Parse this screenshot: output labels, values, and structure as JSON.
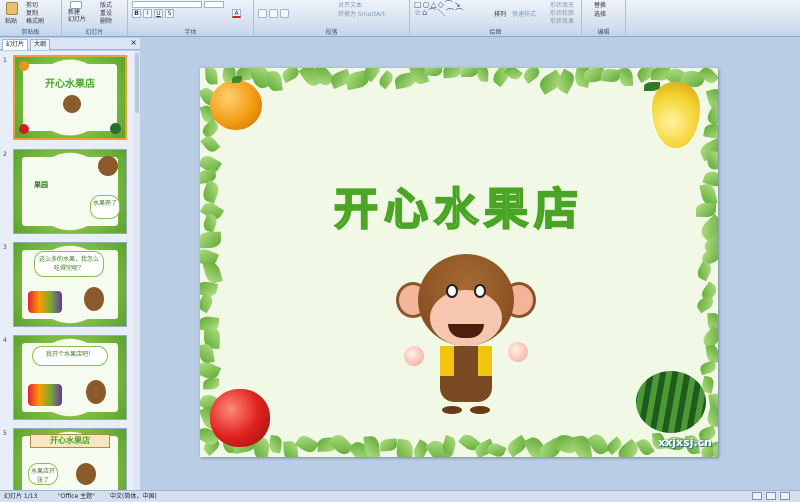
{
  "ribbon": {
    "clipboard": {
      "paste_label": "粘贴",
      "cut_label": "剪切",
      "copy_label": "复制",
      "format_painter_label": "格式刷",
      "group_label": "剪贴板"
    },
    "slides": {
      "new_slide_label": "新建\n幻灯片",
      "layout_label": "版式",
      "reset_label": "重设",
      "delete_label": "删除",
      "group_label": "幻灯片"
    },
    "font": {
      "group_label": "字体",
      "buttons": [
        "B",
        "I",
        "U",
        "S",
        "A"
      ]
    },
    "paragraph": {
      "group_label": "段落",
      "align_text_label": "对齐文本",
      "smartart_label": "转换为 SmartArt"
    },
    "drawing": {
      "group_label": "绘图",
      "arrange_label": "排列",
      "quick_styles_label": "快速样式",
      "shape_fill_label": "形状填充",
      "shape_outline_label": "形状轮廓",
      "shape_effects_label": "形状效果"
    },
    "editing": {
      "group_label": "编辑",
      "replace_label": "替换",
      "select_label": "选择"
    }
  },
  "panel": {
    "tabs": [
      "幻灯片",
      "大纲"
    ],
    "close_icon": "close-icon",
    "thumbnails": [
      {
        "number": "1",
        "title": "开心水果店"
      },
      {
        "number": "2",
        "cloud_text": "水果熟了",
        "center_text": "果园"
      },
      {
        "number": "3",
        "cloud_text": "这么多的水果，我怎么吃得完呢？"
      },
      {
        "number": "4",
        "cloud_text": "我开个水果店吧！"
      },
      {
        "number": "5",
        "title": "开心水果店",
        "cloud_text": "水果店开张了"
      }
    ]
  },
  "slide": {
    "title": "开心水果店",
    "watermark": "xxjxsj.cn",
    "colors": {
      "title_outline": "#4aa525",
      "background": "#f1f9e6",
      "leaf": "#5aa830"
    }
  },
  "status": {
    "slide_indicator": "幻灯片 1/13",
    "theme": "\"Office 主题\"",
    "language": "中文(简体，中国)"
  }
}
